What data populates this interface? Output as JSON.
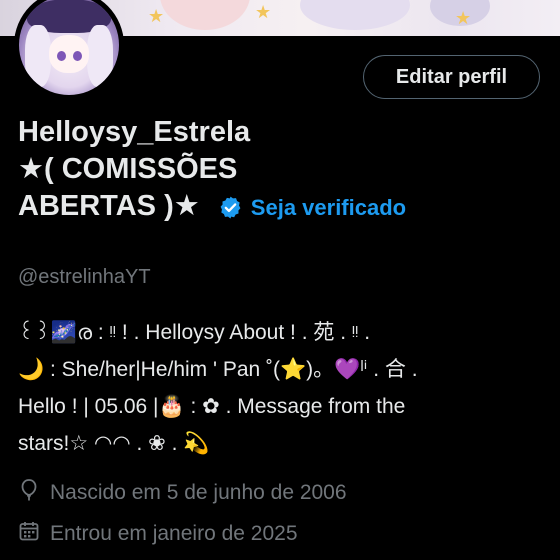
{
  "profile": {
    "name_line1": "Helloysy_Estrela",
    "name_line2": "★( COMISSÕES",
    "name_line3": "ABERTAS )★",
    "verify_label": "Seja verificado",
    "handle": "@estrelinhaYT",
    "edit_button_label": "Editar perfil"
  },
  "bio": {
    "line1": "꒰꒱🌌ര : ᵎᵎ ! . Helloysy About ! . 苑 . ᵎᵎ .",
    "line2": "🌙 : She/her|He/him ' Pan ˚(⭐)。💜ˡⁱ . 合 .",
    "line3": "Hello ! | 05.06 |🎂 : ✿ . Message from the",
    "line4": "stars!☆ ◠◠ . ❀ . 💫"
  },
  "meta": {
    "birthday": "Nascido em 5 de junho de 2006",
    "joined": "Entrou em janeiro de 2025"
  },
  "colors": {
    "background": "#000000",
    "text_primary": "#e7e9ea",
    "text_secondary": "#71767b",
    "accent": "#1d9bf0",
    "button_border": "#536471"
  },
  "icons": {
    "verified": "verified-badge-icon",
    "birthday": "balloon-icon",
    "joined": "calendar-icon"
  }
}
